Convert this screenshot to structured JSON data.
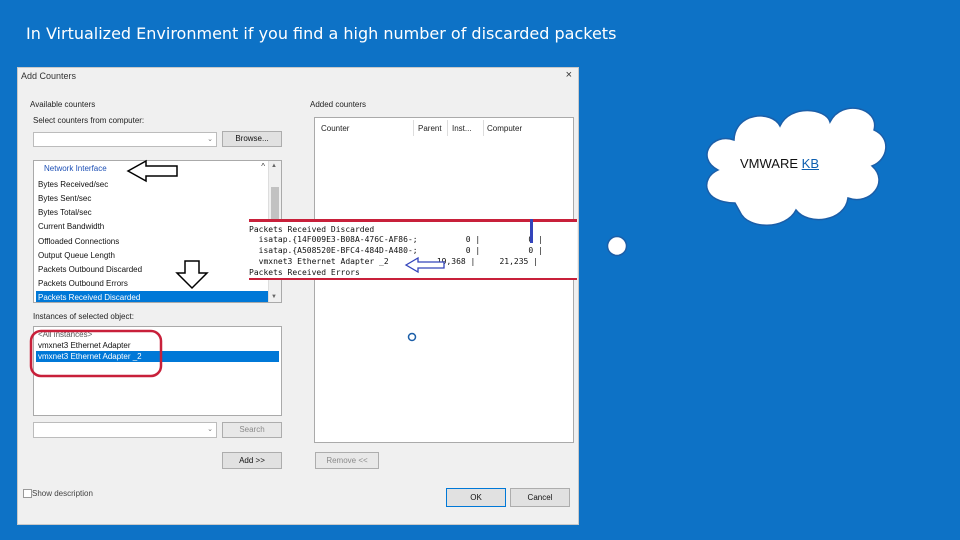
{
  "slide": {
    "title": "In Virtualized Environment if you find a high number of discarded packets",
    "cloud_text": "VMWARE",
    "cloud_link": "KB"
  },
  "dialog": {
    "title": "Add Counters",
    "close_icon": "×",
    "available_counters_label": "Available counters",
    "select_from_computer_label": "Select counters from computer:",
    "computer_value": "",
    "browse_button": "Browse...",
    "counter_group": "Network Interface",
    "counter_items": [
      "Bytes Received/sec",
      "Bytes Sent/sec",
      "Bytes Total/sec",
      "Current Bandwidth",
      "Offloaded Connections",
      "Output Queue Length",
      "Packets Outbound Discarded",
      "Packets Outbound Errors",
      "Packets Received Discarded"
    ],
    "selected_counter": "Packets Received Discarded",
    "instances_label": "Instances of selected object:",
    "instances": [
      "<All instances>",
      "vmxnet3 Ethernet Adapter",
      "vmxnet3 Ethernet Adapter _2"
    ],
    "selected_instance": "vmxnet3 Ethernet Adapter _2",
    "search_button": "Search",
    "add_button": "Add >>",
    "added_counters_label": "Added counters",
    "columns": [
      "Counter",
      "Parent",
      "Inst...",
      "Computer"
    ],
    "remove_button": "Remove <<",
    "show_description_label": "Show description",
    "ok_button": "OK",
    "cancel_button": "Cancel"
  },
  "console": {
    "lines": [
      "Packets Received Discarded",
      "  isatap.{14F009E3-B08A-476C-AF86-;          0 |          0 |",
      "  isatap.{A508520E-BFC4-484D-A480-;          0 |          0 |",
      "  vmxnet3 Ethernet Adapter _2          19,368 |     21,235 |",
      "Packets Received Errors"
    ]
  },
  "colors": {
    "background": "#0d72c6",
    "highlight_red": "#c8203a",
    "selection_blue": "#0078d7"
  }
}
